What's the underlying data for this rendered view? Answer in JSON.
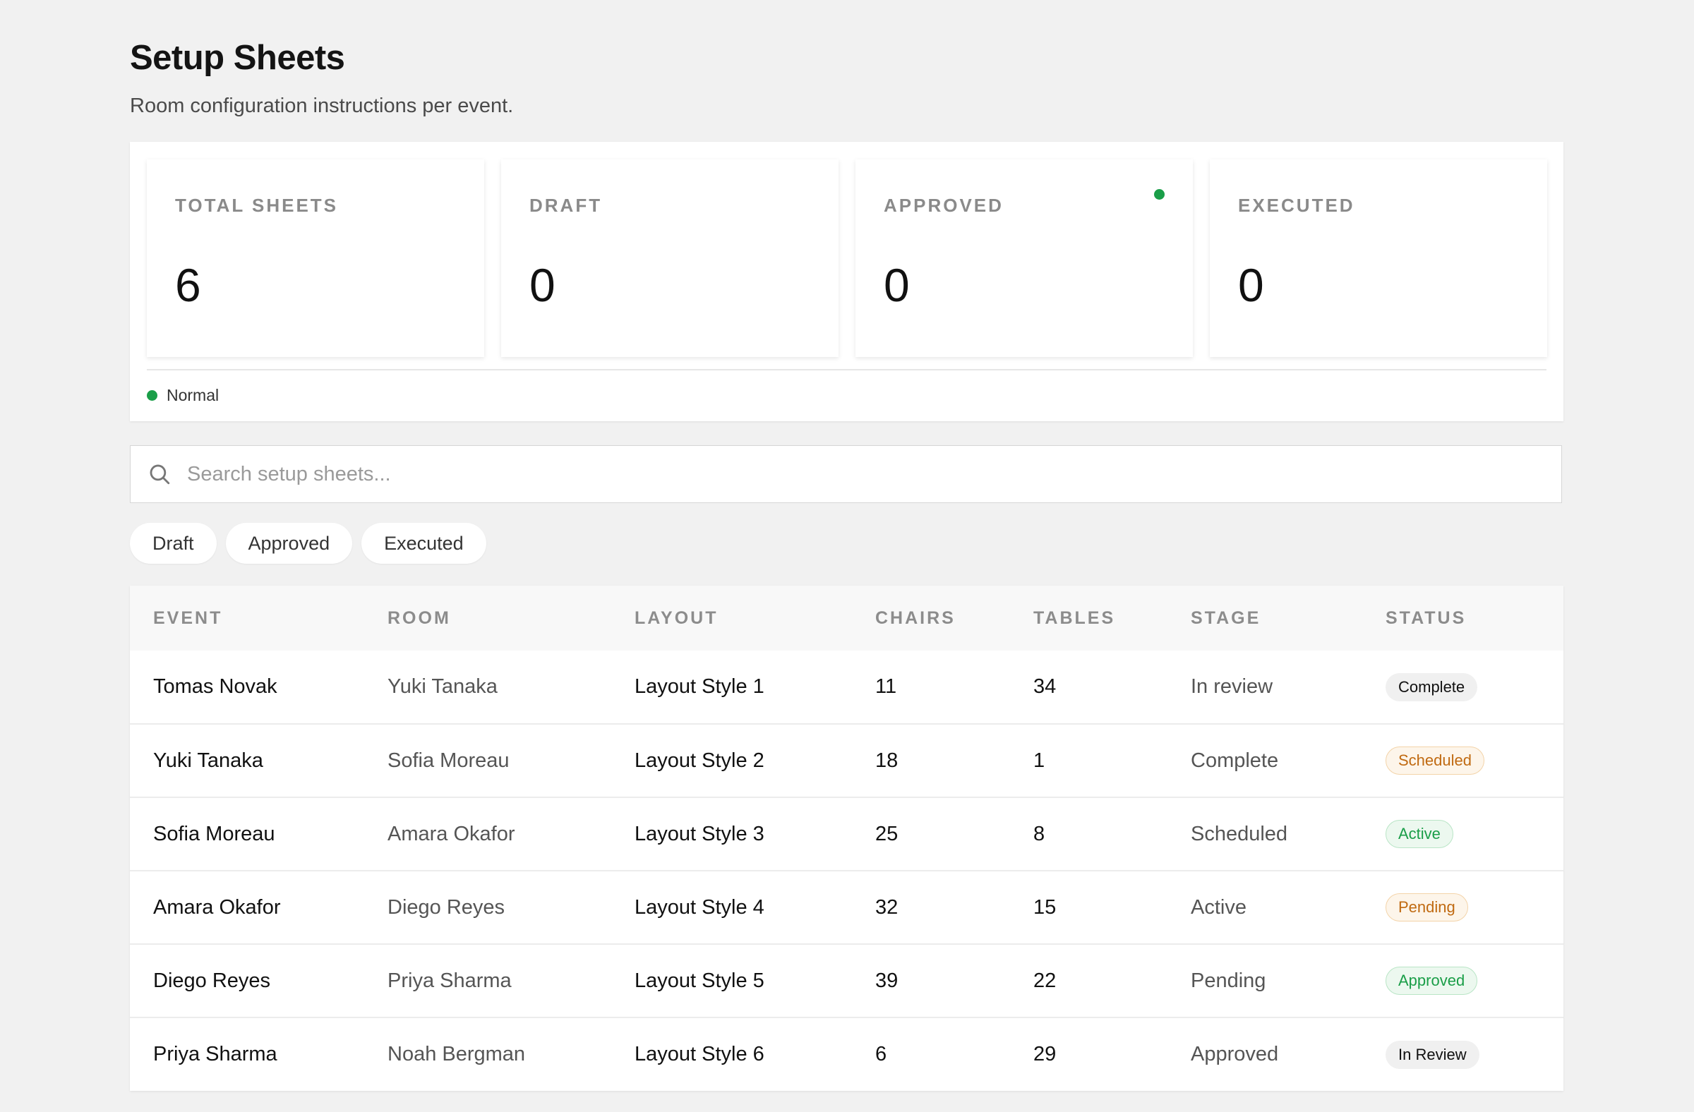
{
  "header": {
    "title": "Setup Sheets",
    "subtitle": "Room configuration instructions per event."
  },
  "stats": [
    {
      "label": "TOTAL SHEETS",
      "value": "6"
    },
    {
      "label": "DRAFT",
      "value": "0"
    },
    {
      "label": "APPROVED",
      "value": "0",
      "indicator": "green-dot"
    },
    {
      "label": "EXECUTED",
      "value": "0"
    }
  ],
  "legend": {
    "label": "Normal",
    "color": "#1a9e48"
  },
  "search": {
    "placeholder": "Search setup sheets...",
    "value": ""
  },
  "filters": [
    "Draft",
    "Approved",
    "Executed"
  ],
  "table": {
    "columns": [
      "EVENT",
      "ROOM",
      "LAYOUT",
      "CHAIRS",
      "TABLES",
      "STAGE",
      "STATUS"
    ],
    "rows": [
      {
        "event": "Tomas Novak",
        "room": "Yuki Tanaka",
        "layout": "Layout Style 1",
        "chairs": "11",
        "tables": "34",
        "stage": "In review",
        "status": "Complete",
        "status_style": "neutral"
      },
      {
        "event": "Yuki Tanaka",
        "room": "Sofia Moreau",
        "layout": "Layout Style 2",
        "chairs": "18",
        "tables": "1",
        "stage": "Complete",
        "status": "Scheduled",
        "status_style": "orange"
      },
      {
        "event": "Sofia Moreau",
        "room": "Amara Okafor",
        "layout": "Layout Style 3",
        "chairs": "25",
        "tables": "8",
        "stage": "Scheduled",
        "status": "Active",
        "status_style": "green"
      },
      {
        "event": "Amara Okafor",
        "room": "Diego Reyes",
        "layout": "Layout Style 4",
        "chairs": "32",
        "tables": "15",
        "stage": "Active",
        "status": "Pending",
        "status_style": "orange"
      },
      {
        "event": "Diego Reyes",
        "room": "Priya Sharma",
        "layout": "Layout Style 5",
        "chairs": "39",
        "tables": "22",
        "stage": "Pending",
        "status": "Approved",
        "status_style": "green"
      },
      {
        "event": "Priya Sharma",
        "room": "Noah Bergman",
        "layout": "Layout Style 6",
        "chairs": "6",
        "tables": "29",
        "stage": "Approved",
        "status": "In Review",
        "status_style": "neutral"
      }
    ]
  }
}
